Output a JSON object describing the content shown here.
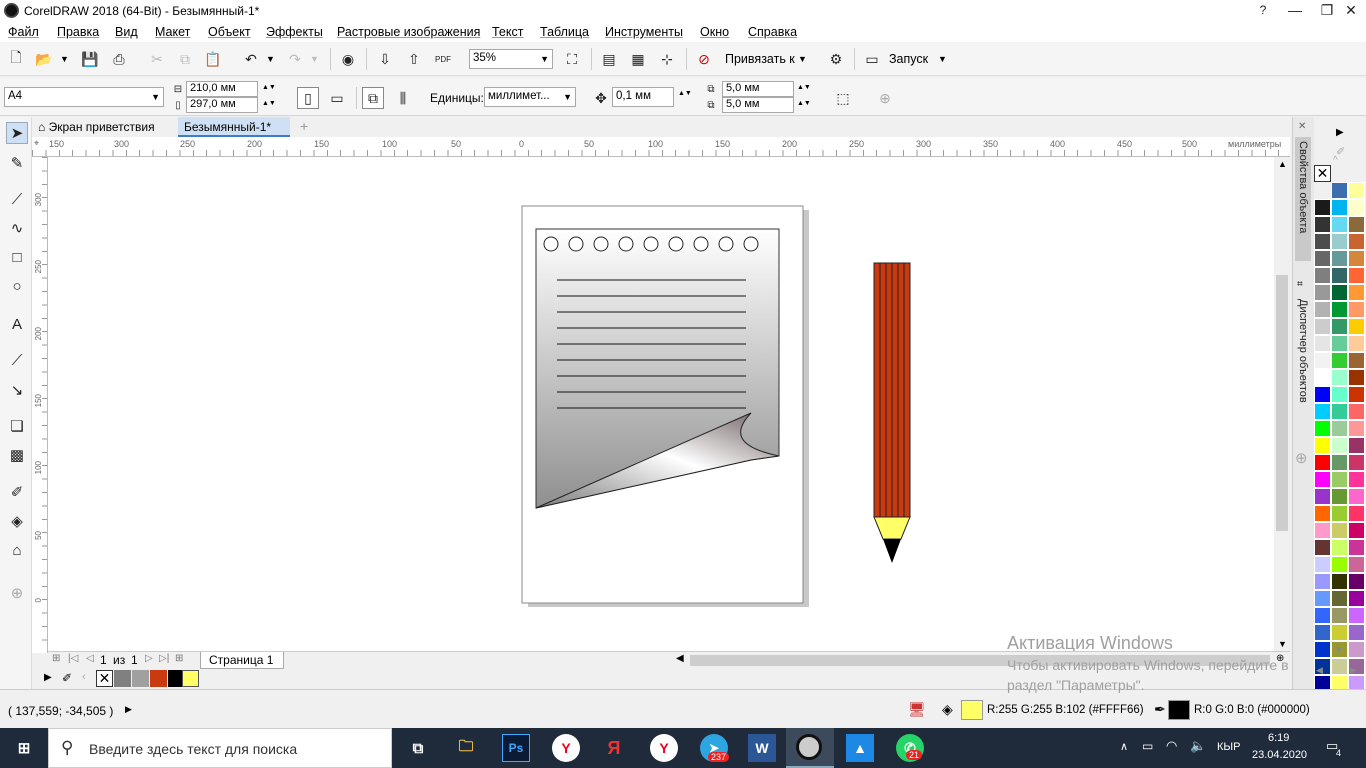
{
  "window": {
    "title": "CorelDRAW 2018 (64-Bit) - Безымянный-1*",
    "minimize": "—",
    "restore": "❐",
    "close": "✕",
    "help_icon": "?"
  },
  "menu": [
    "Файл",
    "Правка",
    "Вид",
    "Макет",
    "Объект",
    "Эффекты",
    "Растровые изображения",
    "Текст",
    "Таблица",
    "Инструменты",
    "Окно",
    "Справка"
  ],
  "toolbar": {
    "zoom": "35%",
    "snap_label": "Привязать к",
    "launch_label": "Запуск",
    "pdf": "PDF"
  },
  "propbar": {
    "page_size": "A4",
    "width": "210,0 мм",
    "height": "297,0 мм",
    "units_label": "Единицы:",
    "units_value": "миллимет...",
    "nudge": "0,1 мм",
    "dup_x": "5,0 мм",
    "dup_y": "5,0 мм"
  },
  "tabs": [
    {
      "label": "Экран приветствия"
    },
    {
      "label": "Безымянный-1*"
    }
  ],
  "ruler": {
    "h_ticks": [
      "150",
      "300",
      "250",
      "200",
      "150",
      "100",
      "50",
      "0",
      "50",
      "100",
      "150",
      "200",
      "250",
      "300",
      "350",
      "400",
      "450",
      "500"
    ],
    "h_unit": "миллиметры",
    "v_ticks": [
      "300",
      "250",
      "200",
      "150",
      "100",
      "50",
      "0"
    ]
  },
  "pager": {
    "current": "1",
    "of_label": "из",
    "total": "1",
    "page_tab": "Страница 1"
  },
  "dock": {
    "props_label": "Свойства объекта",
    "objects_label": "Диспетчер объектов"
  },
  "status": {
    "coords": "( 137,559; -34,505 )",
    "fill": "R:255 G:255 B:102 (#FFFF66)",
    "outline": "R:0 G:0 B:0 (#000000)",
    "fill_color": "#FFFF66",
    "outline_color": "#000000"
  },
  "activation": {
    "title": "Активация Windows",
    "line1": "Чтобы активировать Windows, перейдите в",
    "line2": "раздел \"Параметры\"."
  },
  "taskbar": {
    "search_placeholder": "Введите здесь текст для поиска",
    "time": "6:19",
    "date": "23.04.2020",
    "lang": "КЫР",
    "notif_count": "4",
    "telegram_badge": "237",
    "whatsapp_badge": "21",
    "ps": "Ps"
  },
  "colors": {
    "pencil_body": "#c93a10",
    "pencil_tip": "#ffff66",
    "doc_palette": [
      "#808080",
      "#a0a0a0",
      "#c93a10",
      "#000000",
      "#ffff66"
    ]
  },
  "palette": [
    "#000000",
    "#3d6fb0",
    "#ffff99",
    "#1a1a1a",
    "#00b4f0",
    "#ffffcc",
    "#333333",
    "#66d9f2",
    "#8a6a3a",
    "#4d4d4d",
    "#99cccc",
    "#c86432",
    "#666666",
    "#669999",
    "#d2873c",
    "#7f7f7f",
    "#336666",
    "#ff6633",
    "#999999",
    "#006633",
    "#ff9933",
    "#b2b2b2",
    "#009933",
    "#ff9966",
    "#cccccc",
    "#339966",
    "#ffcc00",
    "#e5e5e5",
    "#66cc99",
    "#ffcc99",
    "#f2f2f2",
    "#33cc33",
    "#996633",
    "#ffffff",
    "#99ffcc",
    "#993300",
    "#0000ff",
    "#66ffcc",
    "#cc3300",
    "#00ccff",
    "#33cc99",
    "#ff6666",
    "#00ff00",
    "#99cc99",
    "#ff9999",
    "#ffff00",
    "#ccffcc",
    "#993366",
    "#ff0000",
    "#669966",
    "#cc3366",
    "#ff00ff",
    "#99cc66",
    "#ff3399",
    "#9933cc",
    "#669933",
    "#ff66cc",
    "#ff6600",
    "#99cc33",
    "#ff3366",
    "#ff99cc",
    "#cccc66",
    "#cc0066",
    "#663333",
    "#ccff66",
    "#cc3399",
    "#ccccff",
    "#99ff00",
    "#cc6699",
    "#9999ff",
    "#333300",
    "#660066",
    "#6699ff",
    "#666633",
    "#990099",
    "#3366ff",
    "#999966",
    "#cc66ff",
    "#3366cc",
    "#cccc33",
    "#9966cc",
    "#0033cc",
    "#999933",
    "#cc99cc",
    "#003399",
    "#cccc99",
    "#996699",
    "#000099",
    "#ffff66",
    "#cc99ff"
  ]
}
